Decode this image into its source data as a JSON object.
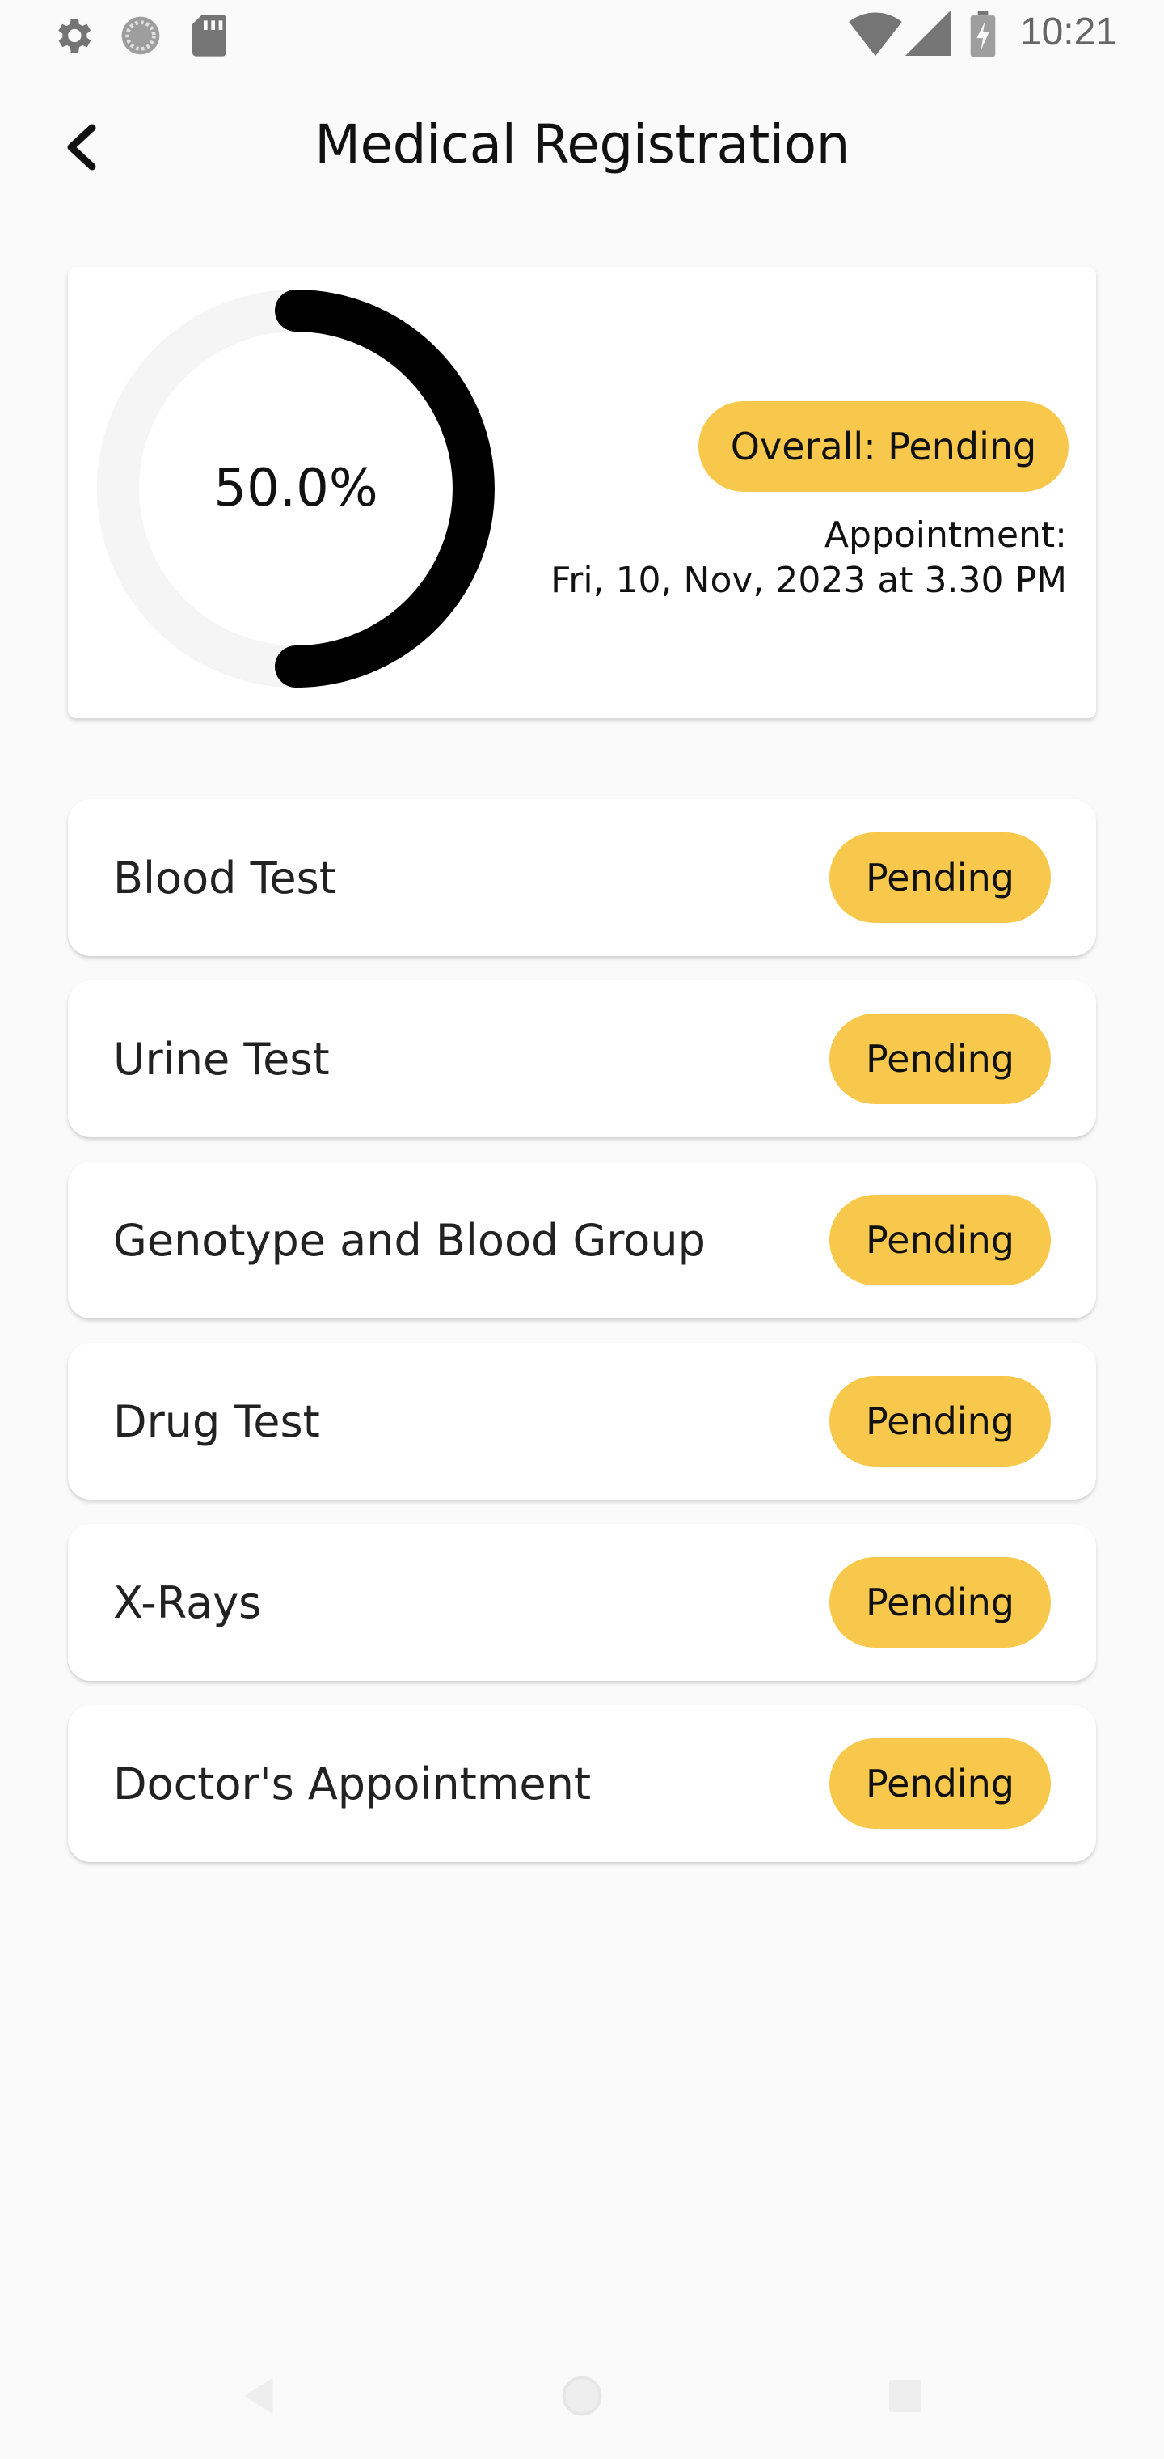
{
  "status_bar": {
    "time": "10:21",
    "left_icons": [
      "settings-icon",
      "sync-icon",
      "sd-card-icon"
    ],
    "right_icons": [
      "wifi-icon",
      "signal-icon",
      "battery-icon"
    ]
  },
  "header": {
    "title": "Medical Registration",
    "back_icon": "chevron-left-icon"
  },
  "summary": {
    "progress_percent": 50.0,
    "progress_label": "50.0%",
    "overall_status": "Overall: Pending",
    "appointment_label": "Appointment:",
    "appointment_date": "Fri, 10, Nov, 2023 at 3.30 PM",
    "colors": {
      "ring_fill": "#000000",
      "ring_track": "#f5f5f5",
      "badge": "#f7c84b"
    }
  },
  "tests": [
    {
      "name": "Blood Test",
      "status": "Pending"
    },
    {
      "name": "Urine Test",
      "status": "Pending"
    },
    {
      "name": "Genotype and Blood Group",
      "status": "Pending"
    },
    {
      "name": "Drug Test",
      "status": "Pending"
    },
    {
      "name": "X-Rays",
      "status": "Pending"
    },
    {
      "name": "Doctor's Appointment",
      "status": "Pending"
    }
  ],
  "nav": {
    "icons": [
      "back-triangle-icon",
      "home-circle-icon",
      "recents-square-icon"
    ]
  }
}
